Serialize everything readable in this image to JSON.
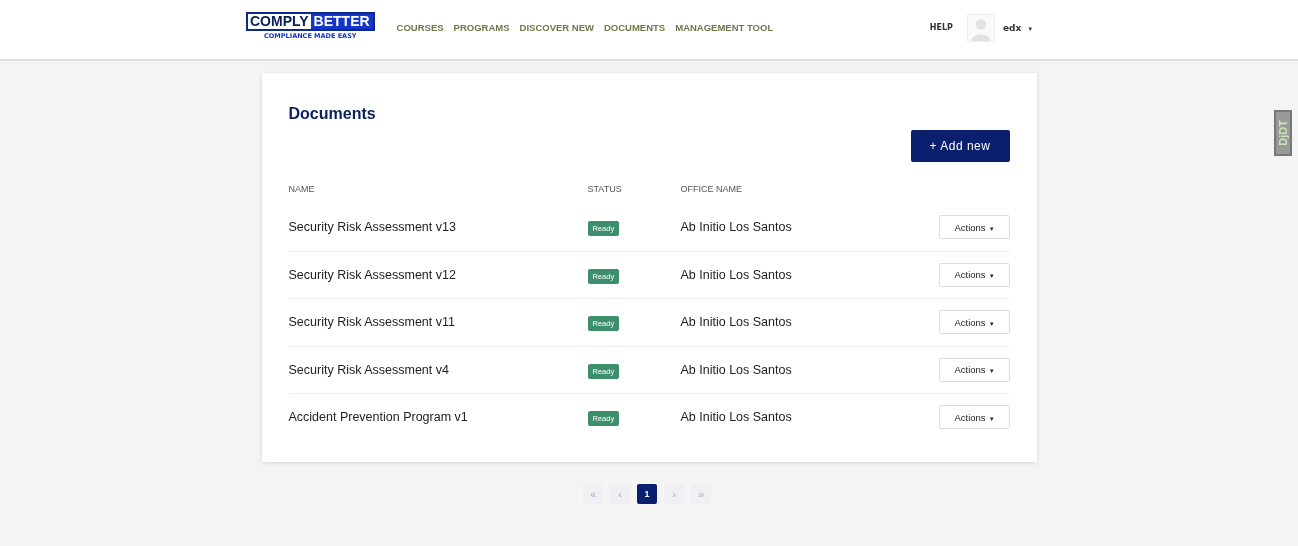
{
  "header": {
    "logo": {
      "word_1": "COMPLY",
      "word_2": "BETTER",
      "tagline": "COMPLIANCE MADE EASY"
    },
    "nav": [
      {
        "label": "COURSES"
      },
      {
        "label": "PROGRAMS"
      },
      {
        "label": "DISCOVER NEW"
      },
      {
        "label": "DOCUMENTS"
      },
      {
        "label": "MANAGEMENT TOOL"
      }
    ],
    "help": "HELP",
    "user": {
      "name": "edx",
      "caret": "▾"
    }
  },
  "debug_toolbar": {
    "label": "DjDT"
  },
  "documents": {
    "title": "Documents",
    "add_button": "+ Add new",
    "table": {
      "columns": [
        "NAME",
        "STATUS",
        "OFFICE NAME"
      ],
      "rows": [
        {
          "name": "Security Risk Assessment v13",
          "status": "Ready",
          "office": "Ab Initio Los Santos",
          "action": "Actions"
        },
        {
          "name": "Security Risk Assessment v12",
          "status": "Ready",
          "office": "Ab Initio Los Santos",
          "action": "Actions"
        },
        {
          "name": "Security Risk Assessment v11",
          "status": "Ready",
          "office": "Ab Initio Los Santos",
          "action": "Actions"
        },
        {
          "name": "Security Risk Assessment v4",
          "status": "Ready",
          "office": "Ab Initio Los Santos",
          "action": "Actions"
        },
        {
          "name": "Accident Prevention Program v1",
          "status": "Ready",
          "office": "Ab Initio Los Santos",
          "action": "Actions"
        }
      ]
    }
  },
  "pagination": [
    {
      "label": "«",
      "selected": false
    },
    {
      "label": "‹",
      "selected": false
    },
    {
      "label": "1",
      "selected": true
    },
    {
      "label": "›",
      "selected": false
    },
    {
      "label": "»",
      "selected": false
    }
  ]
}
